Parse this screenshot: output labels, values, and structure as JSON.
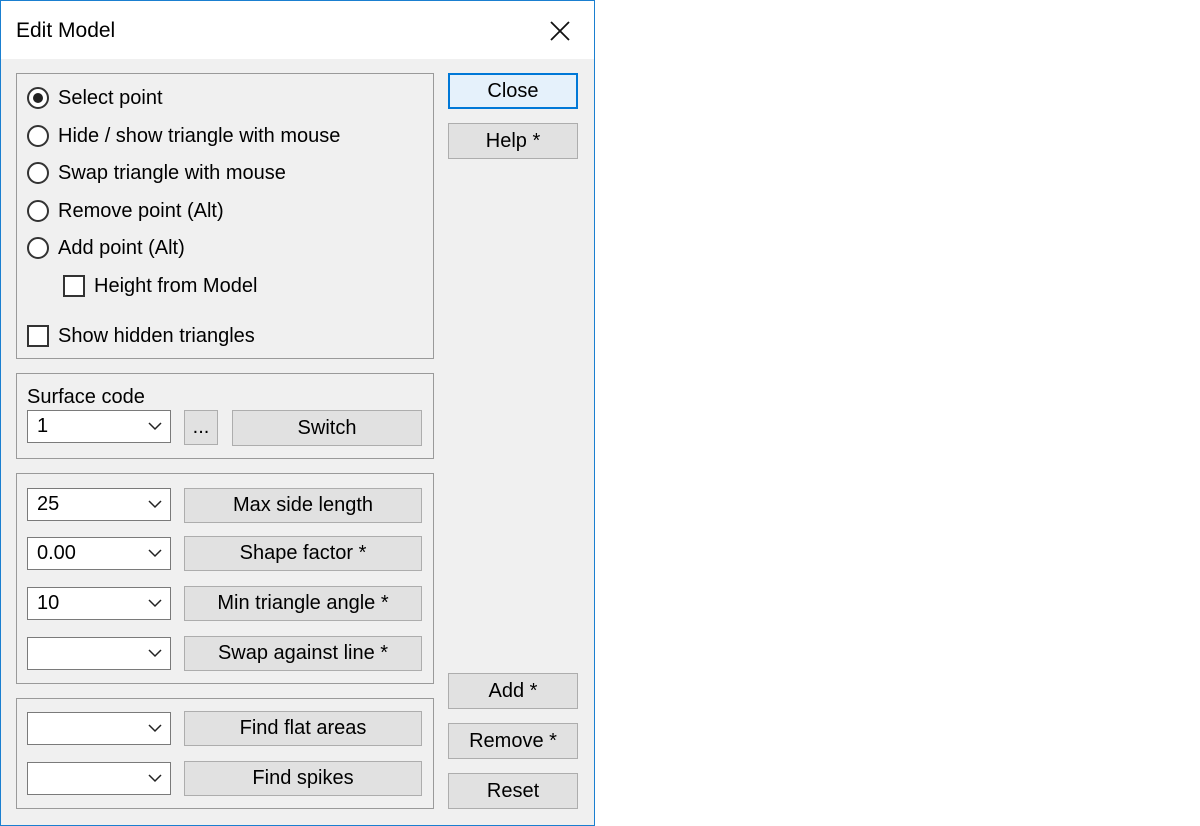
{
  "window": {
    "title": "Edit Model"
  },
  "mode": {
    "options": [
      {
        "label": "Select point",
        "selected": true
      },
      {
        "label": "Hide / show triangle with mouse",
        "selected": false
      },
      {
        "label": "Swap triangle with mouse",
        "selected": false
      },
      {
        "label": "Remove point (Alt)",
        "selected": false
      },
      {
        "label": "Add point (Alt)",
        "selected": false
      }
    ],
    "height_from_model": {
      "label": "Height from Model",
      "checked": false
    },
    "show_hidden": {
      "label": "Show hidden triangles",
      "checked": false
    }
  },
  "surface": {
    "label": "Surface code",
    "value": "1",
    "browse_label": "...",
    "switch_label": "Switch"
  },
  "params": [
    {
      "value": "25",
      "button": "Max side length"
    },
    {
      "value": "0.00",
      "button": "Shape factor *"
    },
    {
      "value": "10",
      "button": "Min triangle angle *"
    },
    {
      "value": "",
      "button": "Swap against line *"
    }
  ],
  "finders": [
    {
      "value": "",
      "button": "Find flat areas"
    },
    {
      "value": "",
      "button": "Find spikes"
    }
  ],
  "side_buttons": {
    "close": "Close",
    "help": "Help *",
    "add": "Add *",
    "remove": "Remove *",
    "reset": "Reset"
  },
  "icons": {
    "close": "close-icon",
    "dropdown": "chevron-down-icon"
  },
  "colors": {
    "accent": "#0078d7",
    "title_bg": "#ffffff",
    "dialog_bg": "#f0f0f0"
  }
}
